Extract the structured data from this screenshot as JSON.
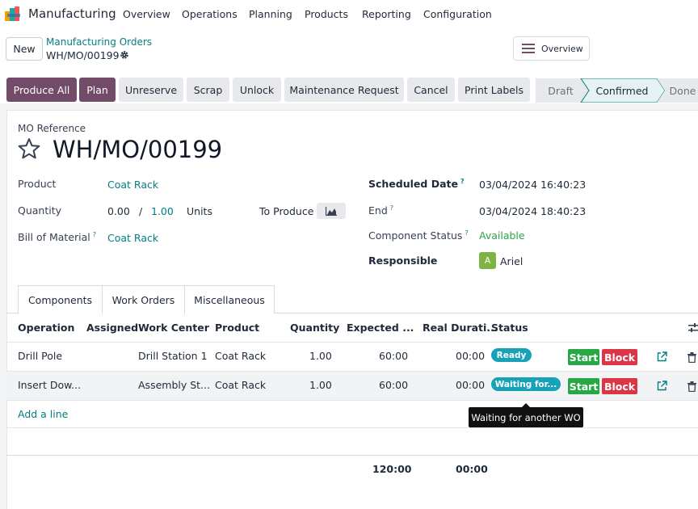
{
  "app": {
    "name": "Manufacturing",
    "menu": [
      "Overview",
      "Operations",
      "Planning",
      "Products",
      "Reporting",
      "Configuration"
    ]
  },
  "control": {
    "new_label": "New",
    "breadcrumb": "Manufacturing Orders",
    "record": "WH/MO/00199",
    "overview_label": "Overview"
  },
  "actions": {
    "produce_all": "Produce All",
    "plan": "Plan",
    "unreserve": "Unreserve",
    "scrap": "Scrap",
    "unlock": "Unlock",
    "maintenance": "Maintenance Request",
    "cancel": "Cancel",
    "print_labels": "Print Labels"
  },
  "status": {
    "stages": [
      "Draft",
      "Confirmed",
      "Done"
    ],
    "current": "Confirmed"
  },
  "form": {
    "ref_label": "MO Reference",
    "title": "WH/MO/00199",
    "product_label": "Product",
    "product_value": "Coat Rack",
    "quantity_label": "Quantity",
    "qty_done": "0.00",
    "qty_sep": "/",
    "qty_total": "1.00",
    "qty_unit": "Units",
    "to_produce": "To Produce",
    "bom_label": "Bill of Material",
    "bom_value": "Coat Rack",
    "scheduled_label": "Scheduled Date",
    "scheduled_value": "03/04/2024 16:40:23",
    "end_label": "End",
    "end_value": "03/04/2024 18:40:23",
    "component_status_label": "Component Status",
    "component_status_value": "Available",
    "responsible_label": "Responsible",
    "responsible_initial": "A",
    "responsible_value": "Ariel",
    "help_mark": "?"
  },
  "tabs": [
    "Components",
    "Work Orders",
    "Miscellaneous"
  ],
  "table": {
    "headers": [
      "Operation",
      "Assigned",
      "Work Center",
      "Product",
      "Quantity",
      "Expected ...",
      "Real Durati...",
      "Status"
    ],
    "rows": [
      {
        "operation": "Drill Pole",
        "assigned": "",
        "work_center": "Drill Station 1",
        "product": "Coat Rack",
        "quantity": "1.00",
        "expected": "60:00",
        "real": "00:00",
        "status": "Ready"
      },
      {
        "operation": "Insert Dow...",
        "assigned": "",
        "work_center": "Assembly St...",
        "product": "Coat Rack",
        "quantity": "1.00",
        "expected": "60:00",
        "real": "00:00",
        "status": "Waiting for..."
      }
    ],
    "start_label": "Start",
    "block_label": "Block",
    "add_line": "Add a line",
    "tooltip": "Waiting for another WO",
    "total_expected": "120:00",
    "total_real": "00:00"
  },
  "colors": {
    "primary": "#714b67",
    "link": "#017e84",
    "badge": "#17a2b8",
    "start": "#28a745",
    "block": "#dc3545"
  }
}
